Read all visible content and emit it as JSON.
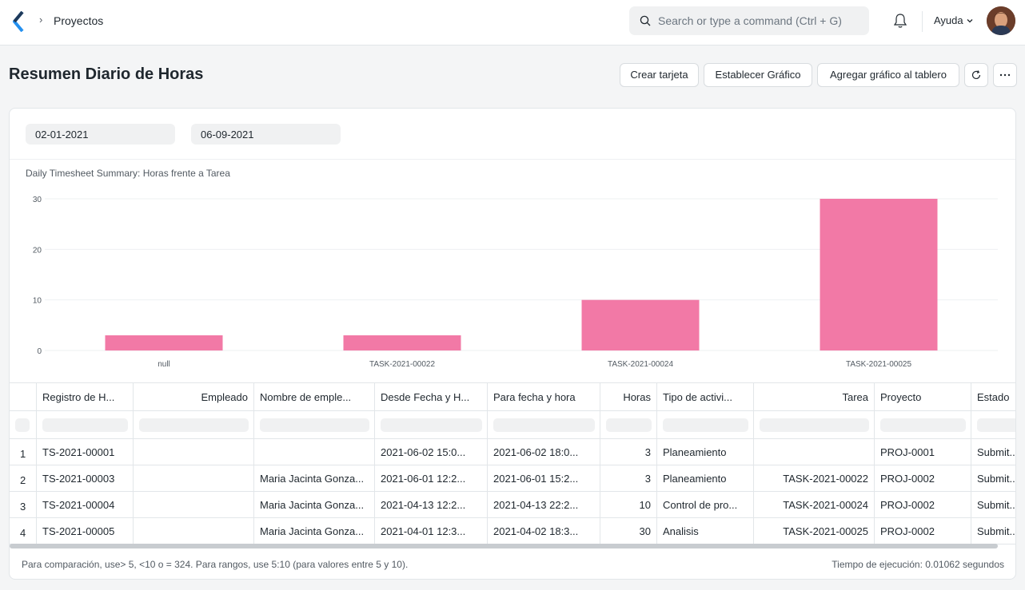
{
  "navbar": {
    "breadcrumb": "Proyectos",
    "search_placeholder": "Search or type a command (Ctrl + G)",
    "help_label": "Ayuda"
  },
  "page": {
    "title": "Resumen Diario de Horas",
    "buttons": {
      "create_card": "Crear tarjeta",
      "set_chart": "Establecer Gráfico",
      "add_chart": "Agregar gráfico al tablero"
    }
  },
  "filters": {
    "from_date": "02-01-2021",
    "to_date": "06-09-2021"
  },
  "chart_data": {
    "type": "bar",
    "title": "Daily Timesheet Summary: Horas frente a Tarea",
    "categories": [
      "null",
      "TASK-2021-00022",
      "TASK-2021-00024",
      "TASK-2021-00025"
    ],
    "values": [
      3,
      3,
      10,
      30
    ],
    "yticks": [
      0,
      10,
      20,
      30
    ],
    "ylim": [
      0,
      30
    ],
    "color": "#f279a6",
    "grid": true
  },
  "table": {
    "columns": [
      "Registro de H...",
      "Empleado",
      "Nombre de emple...",
      "Desde Fecha y H...",
      "Para fecha y hora",
      "Horas",
      "Tipo de activi...",
      "Tarea",
      "Proyecto",
      "Estado"
    ],
    "rows": [
      [
        "1",
        "TS-2021-00001",
        "",
        "",
        "2021-06-02 15:0...",
        "2021-06-02 18:0...",
        "3",
        "Planeamiento",
        "",
        "PROJ-0001",
        "Submit..."
      ],
      [
        "2",
        "TS-2021-00003",
        "",
        "Maria Jacinta Gonza...",
        "2021-06-01 12:2...",
        "2021-06-01 15:2...",
        "3",
        "Planeamiento",
        "TASK-2021-00022",
        "PROJ-0002",
        "Submit..."
      ],
      [
        "3",
        "TS-2021-00004",
        "",
        "Maria Jacinta Gonza...",
        "2021-04-13 12:2...",
        "2021-04-13 22:2...",
        "10",
        "Control de pro...",
        "TASK-2021-00024",
        "PROJ-0002",
        "Submit..."
      ],
      [
        "4",
        "TS-2021-00005",
        "",
        "Maria Jacinta Gonza...",
        "2021-04-01 12:3...",
        "2021-04-02 18:3...",
        "30",
        "Analisis",
        "TASK-2021-00025",
        "PROJ-0002",
        "Submit..."
      ]
    ]
  },
  "footer": {
    "hint": "Para comparación, use> 5, <10 o = 324. Para rangos, use 5:10 (para valores entre 5 y 10).",
    "exec_time": "Tiempo de ejecución: 0.01062 segundos"
  }
}
